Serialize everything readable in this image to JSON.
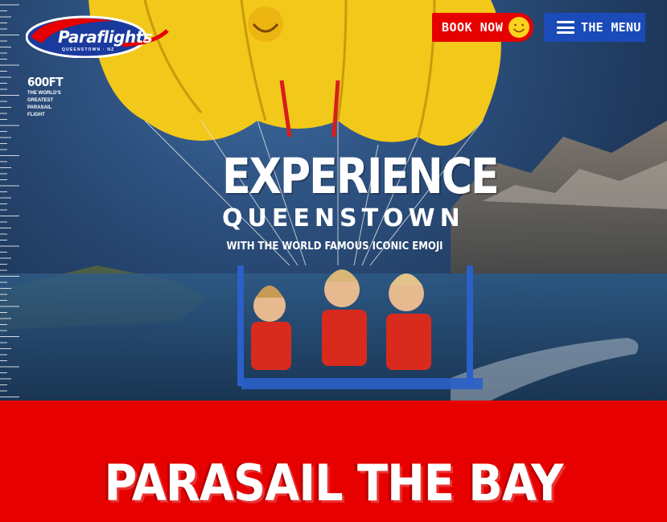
{
  "brand": {
    "name": "Paraflights",
    "tagline": "QUEENSTOWN · NZ"
  },
  "altitude": {
    "value": "600FT",
    "description": "THE WORLD'S GREATEST PARASAIL FLIGHT"
  },
  "nav": {
    "book_label": "BOOK NOW",
    "book_icon": "smiley-face-icon",
    "menu_label": "THE MENU",
    "menu_icon": "hamburger-icon"
  },
  "hero": {
    "headline": "EXPERIENCE",
    "subheadline": "QUEENSTOWN",
    "tagline": "WITH THE WORLD FAMOUS ICONIC EMOJI"
  },
  "section": {
    "title": "PARASAIL THE BAY"
  },
  "colors": {
    "brand_red": "#e60000",
    "menu_blue": "#1a4bb8",
    "canopy_yellow": "#f2c81a",
    "smiley_yellow": "#ffd21c"
  }
}
